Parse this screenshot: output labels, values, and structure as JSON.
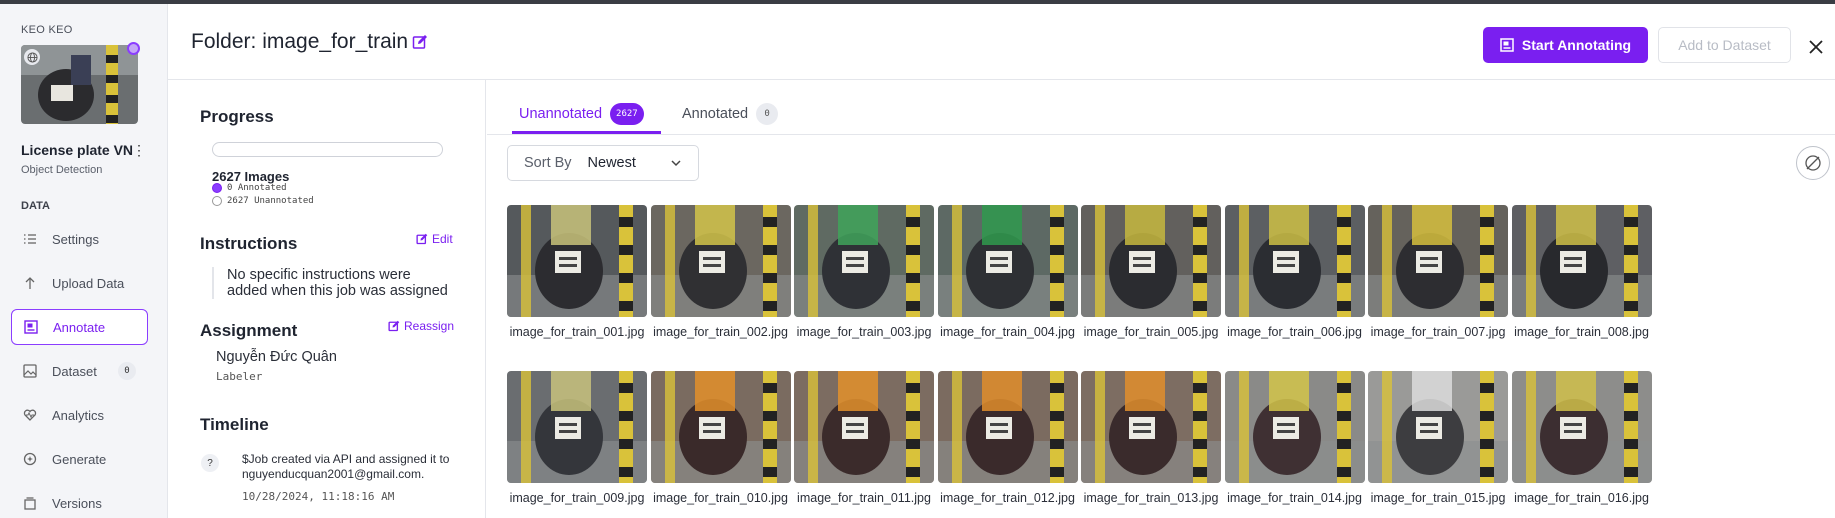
{
  "workspace": "KEO KEO",
  "project": {
    "name": "License plate VN",
    "type": "Object Detection",
    "menu_icon": "kebab-icon"
  },
  "sidebar": {
    "section": "DATA",
    "items": [
      {
        "label": "Settings",
        "icon": "list-icon"
      },
      {
        "label": "Upload Data",
        "icon": "upload-icon"
      },
      {
        "label": "Annotate",
        "icon": "annotate-icon",
        "active": true
      },
      {
        "label": "Dataset",
        "icon": "image-icon",
        "badge": "0"
      },
      {
        "label": "Analytics",
        "icon": "heart-icon"
      },
      {
        "label": "Generate",
        "icon": "sparkle-icon"
      },
      {
        "label": "Versions",
        "icon": "versions-icon"
      }
    ]
  },
  "header": {
    "title": "Folder: image_for_train",
    "start_button": "Start Annotating",
    "dataset_button": "Add to Dataset"
  },
  "info": {
    "progress_heading": "Progress",
    "progress_fraction": 0,
    "images_count": "2627 Images",
    "annotated": "0 Annotated",
    "unannotated": "2627 Unannotated",
    "instructions_heading": "Instructions",
    "edit_label": "Edit",
    "instructions_text": "No specific instructions were added when this job was assigned",
    "assignment_heading": "Assignment",
    "reassign_label": "Reassign",
    "assignee": "Nguyễn Đức Quân",
    "role": "Labeler",
    "timeline_heading": "Timeline",
    "timeline_icon": "?",
    "timeline_text": "$Job created via API and assigned it to nguyenducquan2001@gmail.com.",
    "timeline_date": "10/28/2024, 11:18:16 AM"
  },
  "tabs": [
    {
      "label": "Unannotated",
      "count": "2627",
      "active": true
    },
    {
      "label": "Annotated",
      "count": "0",
      "active": false
    }
  ],
  "sort": {
    "label": "Sort By",
    "value": "Newest"
  },
  "images": [
    "image_for_train_001.jpg",
    "image_for_train_002.jpg",
    "image_for_train_003.jpg",
    "image_for_train_004.jpg",
    "image_for_train_005.jpg",
    "image_for_train_006.jpg",
    "image_for_train_007.jpg",
    "image_for_train_008.jpg",
    "image_for_train_009.jpg",
    "image_for_train_010.jpg",
    "image_for_train_011.jpg",
    "image_for_train_012.jpg",
    "image_for_train_013.jpg",
    "image_for_train_014.jpg",
    "image_for_train_015.jpg",
    "image_for_train_016.jpg"
  ],
  "colors": {
    "accent": "#7a1ff0",
    "accent_light": "#8b3dff"
  }
}
